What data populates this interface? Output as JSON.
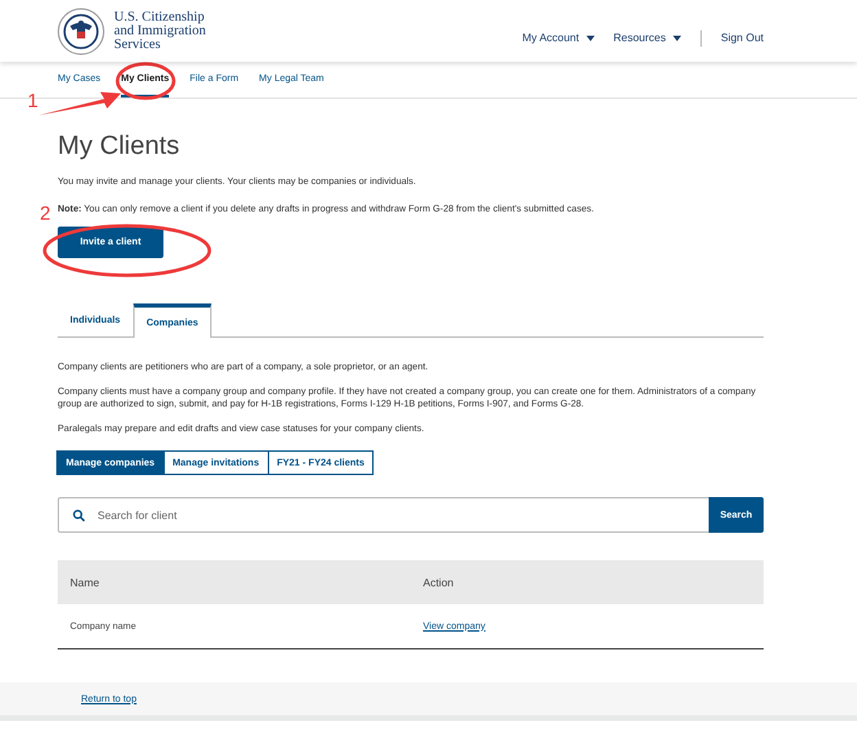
{
  "header": {
    "org_name": [
      "U.S. Citizenship",
      "and Immigration",
      "Services"
    ],
    "menu": [
      {
        "label": "My Account",
        "dropdown": true
      },
      {
        "label": "Resources",
        "dropdown": true
      },
      {
        "label": "Sign Out",
        "dropdown": false
      }
    ]
  },
  "nav": [
    {
      "label": "My Cases",
      "selected": false
    },
    {
      "label": "My Clients",
      "selected": true
    },
    {
      "label": "File a Form",
      "selected": false
    },
    {
      "label": "My Legal Team",
      "selected": false
    }
  ],
  "page": {
    "title": "My Clients",
    "intro": "You may invite and manage your clients. Your clients may be companies or individuals.",
    "note": "**Note:** You can only remove a client if you delete any drafts in progress and withdraw Form G-28 from the client's submitted cases.",
    "invite_button": "Invite a client"
  },
  "tabs": [
    {
      "label": "Individuals",
      "selected": false
    },
    {
      "label": "Companies",
      "selected": true
    }
  ],
  "paragraphs": [
    "Company clients are petitioners who are part of a company, a sole proprietor, or an agent.",
    "Company clients must have a company group and company profile. If they have not created a company group, you can create one for them. Administrators of a company group are authorized to sign, submit, and pay for H-1B registrations, Forms I-129 H-1B petitions, Forms I-907, and Forms G-28.",
    "Paralegals may prepare and edit drafts and view case statuses for your company clients."
  ],
  "segments": [
    {
      "label": "Manage companies",
      "selected": true
    },
    {
      "label": "Manage invitations",
      "selected": false
    },
    {
      "label": "FY21 - FY24 clients",
      "selected": false
    }
  ],
  "search": {
    "placeholder": "Search for client",
    "button": "Search"
  },
  "table": {
    "columns": [
      "Name",
      "Action"
    ],
    "rows": [
      {
        "name": "Company name",
        "action": "View company"
      }
    ]
  },
  "footer": {
    "link": "Return to top"
  },
  "annotations": [
    {
      "label": "1",
      "kind": "arrow"
    },
    {
      "label": "2",
      "kind": "ellipse"
    }
  ]
}
